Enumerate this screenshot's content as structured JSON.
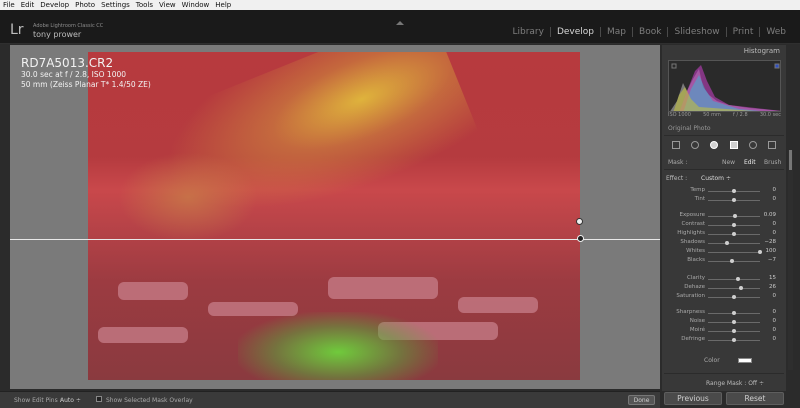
{
  "menu": [
    "File",
    "Edit",
    "Develop",
    "Photo",
    "Settings",
    "Tools",
    "View",
    "Window",
    "Help"
  ],
  "identity": {
    "logo": "Lr",
    "product": "Adobe Lightroom Classic CC",
    "user": "tony prower"
  },
  "modules": [
    {
      "label": "Library",
      "active": false
    },
    {
      "label": "Develop",
      "active": true
    },
    {
      "label": "Map",
      "active": false
    },
    {
      "label": "Book",
      "active": false
    },
    {
      "label": "Slideshow",
      "active": false
    },
    {
      "label": "Print",
      "active": false
    },
    {
      "label": "Web",
      "active": false
    }
  ],
  "photo": {
    "filename": "RD7A5013.CR2",
    "exposure": "30.0 sec at f / 2.8, ISO 1000",
    "lens": "50 mm (Zeiss Planar T* 1.4/50 ZE)"
  },
  "histogram": {
    "title": "Histogram",
    "meta": [
      "ISO 1000",
      "50 mm",
      "f / 2.8",
      "30.0 sec"
    ],
    "original_photo": "Original Photo"
  },
  "mask": {
    "label": "Mask :",
    "new": "New",
    "edit": "Edit",
    "brush": "Brush"
  },
  "effect": {
    "label": "Effect :",
    "value": "Custom ÷"
  },
  "sliders": [
    {
      "label": "Temp",
      "value": "0",
      "pos": 0.5
    },
    {
      "label": "Tint",
      "value": "0",
      "pos": 0.5
    },
    {
      "label": "Exposure",
      "value": "0.09",
      "pos": 0.51
    },
    {
      "label": "Contrast",
      "value": "0",
      "pos": 0.5
    },
    {
      "label": "Highlights",
      "value": "0",
      "pos": 0.5
    },
    {
      "label": "Shadows",
      "value": "−28",
      "pos": 0.36
    },
    {
      "label": "Whites",
      "value": "100",
      "pos": 1.0
    },
    {
      "label": "Blacks",
      "value": "−7",
      "pos": 0.46
    },
    {
      "label": "Clarity",
      "value": "15",
      "pos": 0.58
    },
    {
      "label": "Dehaze",
      "value": "26",
      "pos": 0.63
    },
    {
      "label": "Saturation",
      "value": "0",
      "pos": 0.5
    },
    {
      "label": "Sharpness",
      "value": "0",
      "pos": 0.5
    },
    {
      "label": "Noise",
      "value": "0",
      "pos": 0.5
    },
    {
      "label": "Moiré",
      "value": "0",
      "pos": 0.5
    },
    {
      "label": "Defringe",
      "value": "0",
      "pos": 0.5
    }
  ],
  "color_label": "Color",
  "range_mask": "Range Mask : Off ÷",
  "toolbar": {
    "show_pins_label": "Show Edit Pins :",
    "show_pins_value": "Auto ÷",
    "overlay_label": "Show Selected Mask Overlay",
    "done": "Done"
  },
  "buttons": {
    "previous": "Previous",
    "reset": "Reset"
  }
}
